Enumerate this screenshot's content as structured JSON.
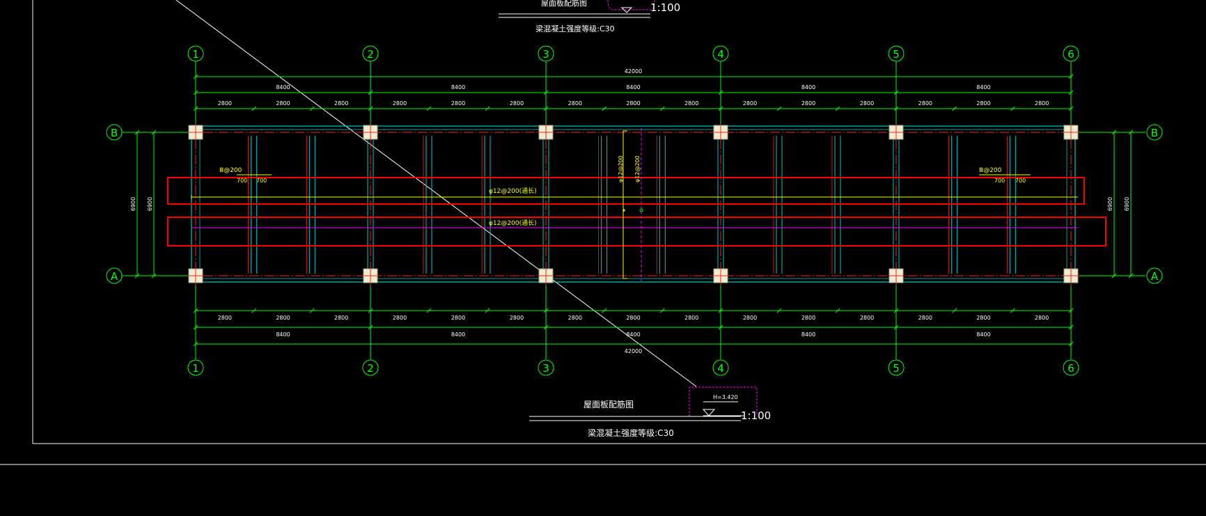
{
  "drawing": {
    "title_top": "屋面板配筋图",
    "grade_top": "梁混凝土强度等级:C30",
    "scale_top": "1:100",
    "title_bottom": "屋面板配筋图",
    "grade_bottom": "梁混凝土强度等级:C30",
    "scale_bottom": "1:100",
    "elevation": "H=3.420"
  },
  "grid": {
    "columns": [
      "1",
      "2",
      "3",
      "4",
      "5",
      "6"
    ],
    "rows": [
      "B",
      "A"
    ]
  },
  "dims": {
    "total": "42000",
    "bays": [
      "8400",
      "8400",
      "8400",
      "8400",
      "8400"
    ],
    "sub_bays": [
      "2800",
      "2800",
      "2800",
      "2800",
      "2800",
      "2800",
      "2800",
      "2800",
      "2800",
      "2800",
      "2800",
      "2800",
      "2800",
      "2800",
      "2800"
    ],
    "side_outer": "6900",
    "side_inner": "6900"
  },
  "rebar": {
    "left_note": "Ⅲ@200",
    "left_sub_a": "700",
    "left_sub_b": "700",
    "right_note": "Ⅲ@200",
    "right_sub_a": "700",
    "right_sub_b": "700",
    "top_bar": "φ12@200(通长)",
    "bottom_bar": "φ12@200(通长)",
    "vert_a": "φ12@200",
    "vert_b": "φ12@200"
  },
  "colors": {
    "background": "#000000",
    "grid_green": "#00ff00",
    "axis_red": "#ff2020",
    "beam_cyan": "#00c8c8",
    "highlight_red": "#ff0000",
    "rebar_magenta": "#ff00ff",
    "text_yellow": "#ffff00",
    "text_white": "#ffffff",
    "column_fill": "#f0ecd0"
  }
}
